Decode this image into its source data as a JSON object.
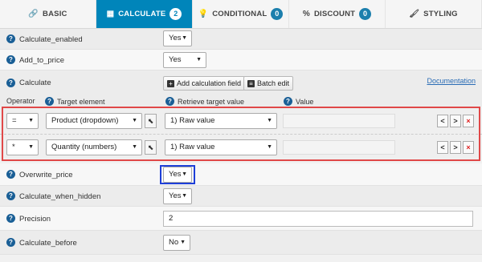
{
  "tabs": [
    {
      "icon": "🔗",
      "label": "BASIC"
    },
    {
      "icon": "▦",
      "label": "CALCULATE",
      "badge": "2"
    },
    {
      "icon": "💡",
      "label": "CONDITIONAL",
      "badge": "0"
    },
    {
      "icon": "%",
      "label": "DISCOUNT",
      "badge": "0"
    },
    {
      "icon": "🖌",
      "label": "STYLING"
    }
  ],
  "fields": {
    "calculate_enabled": {
      "label": "Calculate_enabled",
      "value": "Yes"
    },
    "add_to_price": {
      "label": "Add_to_price",
      "value": "Yes"
    },
    "calculate": {
      "label": "Calculate",
      "add_btn": "Add calculation field",
      "batch_btn": "Batch edit",
      "doc_link": "Documentation"
    },
    "overwrite_price": {
      "label": "Overwrite_price",
      "value": "Yes"
    },
    "calculate_when_hidden": {
      "label": "Calculate_when_hidden",
      "value": "Yes"
    },
    "precision": {
      "label": "Precision",
      "value": "2"
    },
    "calculate_before": {
      "label": "Calculate_before",
      "value": "No"
    }
  },
  "columns": {
    "operator": "Operator",
    "target": "Target element",
    "retrieve": "Retrieve target value",
    "value": "Value"
  },
  "calc_rows": [
    {
      "operator": "=",
      "target": "Product (dropdown)",
      "retrieve": "1) Raw value",
      "value": ""
    },
    {
      "operator": "*",
      "target": "Quantity (numbers)",
      "retrieve": "1) Raw value",
      "value": ""
    }
  ],
  "glyphs": {
    "caret": "▼",
    "pointer": "⬉",
    "left": "<",
    "right": ">",
    "delete": "×",
    "help": "?",
    "plus": "+",
    "list": "≡"
  },
  "colors": {
    "accent": "#0085ba",
    "highlight_red": "#e04848",
    "highlight_blue": "#1e3fd8"
  }
}
